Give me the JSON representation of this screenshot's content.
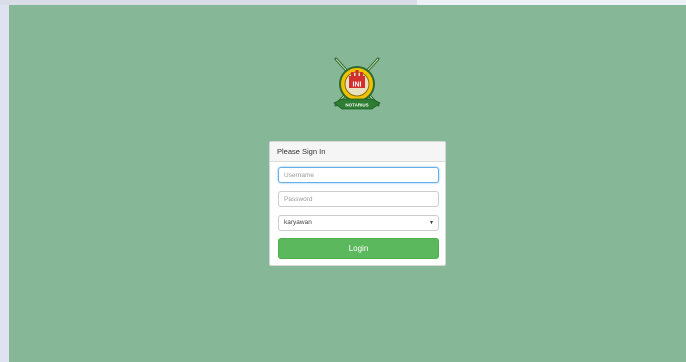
{
  "logo": {
    "text": "NOTARIUS",
    "badge": "INI",
    "colors": {
      "green": "#2e7d32",
      "red": "#d32f2f",
      "gold": "#f2c200"
    }
  },
  "panel": {
    "heading": "Please Sign In",
    "username_placeholder": "Username",
    "password_placeholder": "Password",
    "role_selected": "karyawan",
    "login_label": "Login"
  },
  "colors": {
    "background": "#86b898",
    "login_button": "#5cb85c"
  }
}
